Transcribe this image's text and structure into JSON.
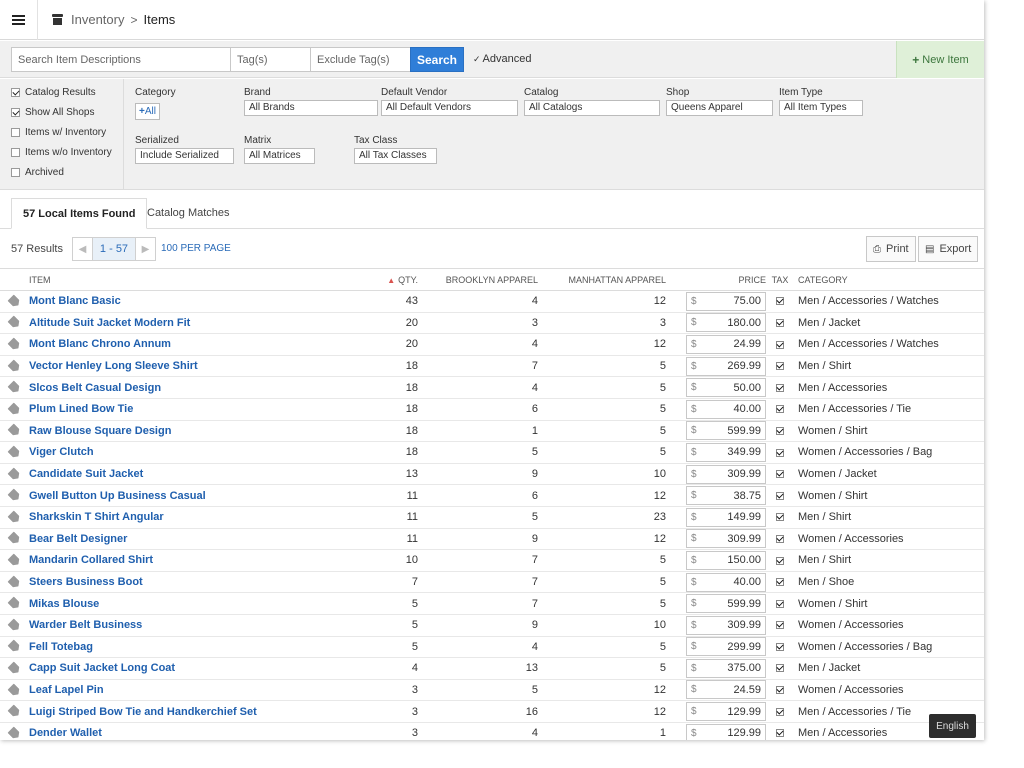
{
  "header": {
    "breadcrumb_parent": "Inventory",
    "breadcrumb_sep": ">",
    "page_title": "Items"
  },
  "search": {
    "descriptions_placeholder": "Search Item Descriptions",
    "tags_placeholder": "Tag(s)",
    "exclude_tags_placeholder": "Exclude Tag(s)",
    "search_label": "Search",
    "advanced_label": "Advanced",
    "new_item_label": "New Item"
  },
  "filters": {
    "checks": [
      {
        "label": "Catalog Results",
        "checked": true
      },
      {
        "label": "Show All Shops",
        "checked": true
      },
      {
        "label": "Items w/ Inventory",
        "checked": false
      },
      {
        "label": "Items w/o Inventory",
        "checked": false
      },
      {
        "label": "Archived",
        "checked": false
      }
    ],
    "category_label": "Category",
    "category_all": "All",
    "brand_label": "Brand",
    "brand_value": "All Brands",
    "vendor_label": "Default Vendor",
    "vendor_value": "All Default Vendors",
    "catalog_label": "Catalog",
    "catalog_value": "All Catalogs",
    "shop_label": "Shop",
    "shop_value": "Queens Apparel",
    "itemtype_label": "Item Type",
    "itemtype_value": "All Item Types",
    "serialized_label": "Serialized",
    "serialized_value": "Include Serialized",
    "matrix_label": "Matrix",
    "matrix_value": "All Matrices",
    "taxclass_label": "Tax Class",
    "taxclass_value": "All Tax Classes"
  },
  "tabs": [
    {
      "label": "57 Local Items Found"
    },
    {
      "label": "Catalog Matches"
    }
  ],
  "results": {
    "count": "57 Results",
    "range": "1 - 57",
    "per_page": "100 PER PAGE",
    "print_label": "Print",
    "export_label": "Export"
  },
  "table": {
    "columns": {
      "item": "ITEM",
      "qty": "QTY.",
      "brooklyn": "BROOKLYN APPAREL",
      "manhattan": "MANHATTAN APPAREL",
      "price": "PRICE",
      "tax": "TAX",
      "category": "CATEGORY"
    },
    "currency": "$",
    "rows": [
      {
        "name": "Mont Blanc Basic",
        "qty": "43",
        "brooklyn": "4",
        "manhattan": "12",
        "price": "75.00",
        "category": "Men / Accessories / Watches"
      },
      {
        "name": "Altitude Suit Jacket Modern Fit",
        "qty": "20",
        "brooklyn": "3",
        "manhattan": "3",
        "price": "180.00",
        "category": "Men / Jacket"
      },
      {
        "name": "Mont Blanc Chrono Annum",
        "qty": "20",
        "brooklyn": "4",
        "manhattan": "12",
        "price": "24.99",
        "category": "Men / Accessories / Watches"
      },
      {
        "name": "Vector Henley Long Sleeve Shirt",
        "qty": "18",
        "brooklyn": "7",
        "manhattan": "5",
        "price": "269.99",
        "category": "Men / Shirt"
      },
      {
        "name": "Slcos Belt Casual Design",
        "qty": "18",
        "brooklyn": "4",
        "manhattan": "5",
        "price": "50.00",
        "category": "Men / Accessories"
      },
      {
        "name": "Plum Lined Bow Tie",
        "qty": "18",
        "brooklyn": "6",
        "manhattan": "5",
        "price": "40.00",
        "category": "Men / Accessories / Tie"
      },
      {
        "name": "Raw Blouse Square Design",
        "qty": "18",
        "brooklyn": "1",
        "manhattan": "5",
        "price": "599.99",
        "category": "Women / Shirt"
      },
      {
        "name": "Viger Clutch",
        "qty": "18",
        "brooklyn": "5",
        "manhattan": "5",
        "price": "349.99",
        "category": "Women / Accessories / Bag"
      },
      {
        "name": "Candidate Suit Jacket",
        "qty": "13",
        "brooklyn": "9",
        "manhattan": "10",
        "price": "309.99",
        "category": "Women / Jacket"
      },
      {
        "name": "Gwell Button Up Business Casual",
        "qty": "11",
        "brooklyn": "6",
        "manhattan": "12",
        "price": "38.75",
        "category": "Women / Shirt"
      },
      {
        "name": "Sharkskin T Shirt Angular",
        "qty": "11",
        "brooklyn": "5",
        "manhattan": "23",
        "price": "149.99",
        "category": "Men / Shirt"
      },
      {
        "name": "Bear Belt Designer",
        "qty": "11",
        "brooklyn": "9",
        "manhattan": "12",
        "price": "309.99",
        "category": "Women / Accessories"
      },
      {
        "name": "Mandarin Collared Shirt",
        "qty": "10",
        "brooklyn": "7",
        "manhattan": "5",
        "price": "150.00",
        "category": "Men / Shirt"
      },
      {
        "name": "Steers Business Boot",
        "qty": "7",
        "brooklyn": "7",
        "manhattan": "5",
        "price": "40.00",
        "category": "Men / Shoe"
      },
      {
        "name": "Mikas Blouse",
        "qty": "5",
        "brooklyn": "7",
        "manhattan": "5",
        "price": "599.99",
        "category": "Women / Shirt"
      },
      {
        "name": "Warder Belt Business",
        "qty": "5",
        "brooklyn": "9",
        "manhattan": "10",
        "price": "309.99",
        "category": "Women / Accessories"
      },
      {
        "name": "Fell Totebag",
        "qty": "5",
        "brooklyn": "4",
        "manhattan": "5",
        "price": "299.99",
        "category": "Women / Accessories / Bag"
      },
      {
        "name": "Capp Suit Jacket Long Coat",
        "qty": "4",
        "brooklyn": "13",
        "manhattan": "5",
        "price": "375.00",
        "category": "Men / Jacket"
      },
      {
        "name": "Leaf Lapel Pin",
        "qty": "3",
        "brooklyn": "5",
        "manhattan": "12",
        "price": "24.59",
        "category": "Women / Accessories"
      },
      {
        "name": "Luigi Striped Bow Tie and Handkerchief Set",
        "qty": "3",
        "brooklyn": "16",
        "manhattan": "12",
        "price": "129.99",
        "category": "Men / Accessories / Tie"
      },
      {
        "name": "Dender Wallet",
        "qty": "3",
        "brooklyn": "4",
        "manhattan": "1",
        "price": "129.99",
        "category": "Men / Accessories"
      }
    ]
  },
  "language": "English",
  "colors": {
    "accent": "#2f7ed8",
    "link": "#1f5fae",
    "new_item_bg": "#dff0d8",
    "new_item_text": "#3c763d"
  }
}
